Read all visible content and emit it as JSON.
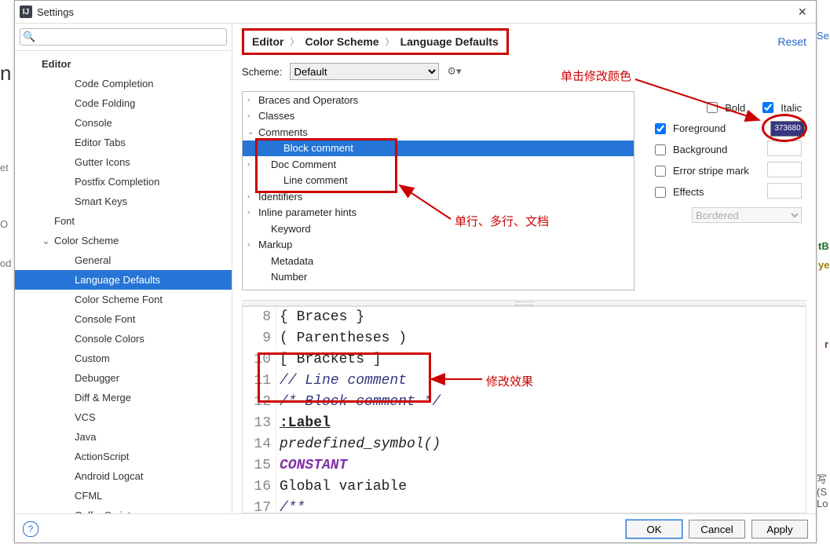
{
  "window": {
    "title": "Settings"
  },
  "search": {
    "placeholder": ""
  },
  "sidebar": {
    "items": [
      {
        "label": "Editor",
        "depth": 0,
        "bold": true,
        "toggle": ""
      },
      {
        "label": "Code Completion",
        "depth": 2
      },
      {
        "label": "Code Folding",
        "depth": 2
      },
      {
        "label": "Console",
        "depth": 2
      },
      {
        "label": "Editor Tabs",
        "depth": 2
      },
      {
        "label": "Gutter Icons",
        "depth": 2
      },
      {
        "label": "Postfix Completion",
        "depth": 2
      },
      {
        "label": "Smart Keys",
        "depth": 2
      },
      {
        "label": "Font",
        "depth": 1
      },
      {
        "label": "Color Scheme",
        "depth": 1,
        "toggle": "v"
      },
      {
        "label": "General",
        "depth": 2
      },
      {
        "label": "Language Defaults",
        "depth": 2,
        "selected": true
      },
      {
        "label": "Color Scheme Font",
        "depth": 2
      },
      {
        "label": "Console Font",
        "depth": 2
      },
      {
        "label": "Console Colors",
        "depth": 2
      },
      {
        "label": "Custom",
        "depth": 2
      },
      {
        "label": "Debugger",
        "depth": 2
      },
      {
        "label": "Diff & Merge",
        "depth": 2
      },
      {
        "label": "VCS",
        "depth": 2
      },
      {
        "label": "Java",
        "depth": 2
      },
      {
        "label": "ActionScript",
        "depth": 2
      },
      {
        "label": "Android Logcat",
        "depth": 2
      },
      {
        "label": "CFML",
        "depth": 2
      },
      {
        "label": "CoffeeScript",
        "depth": 2
      }
    ]
  },
  "breadcrumb": {
    "a": "Editor",
    "b": "Color Scheme",
    "c": "Language Defaults"
  },
  "reset_label": "Reset",
  "scheme": {
    "label": "Scheme:",
    "value": "Default"
  },
  "attrs": {
    "rows": [
      {
        "label": "Braces and Operators",
        "toggle": ">",
        "lv": 0
      },
      {
        "label": "Classes",
        "toggle": ">",
        "lv": 0
      },
      {
        "label": "Comments",
        "toggle": "v",
        "lv": 0
      },
      {
        "label": "Block comment",
        "toggle": "",
        "lv": 2,
        "selected": true
      },
      {
        "label": "Doc Comment",
        "toggle": ">",
        "lv": 1
      },
      {
        "label": "Line comment",
        "toggle": "",
        "lv": 2
      },
      {
        "label": "Identifiers",
        "toggle": ">",
        "lv": 0
      },
      {
        "label": "Inline parameter hints",
        "toggle": ">",
        "lv": 0
      },
      {
        "label": "Keyword",
        "toggle": "",
        "lv": 1
      },
      {
        "label": "Markup",
        "toggle": ">",
        "lv": 0
      },
      {
        "label": "Metadata",
        "toggle": "",
        "lv": 1
      },
      {
        "label": "Number",
        "toggle": "",
        "lv": 1
      }
    ]
  },
  "panel": {
    "bold": "Bold",
    "italic": "Italic",
    "bold_checked": false,
    "italic_checked": true,
    "foreground": "Foreground",
    "fg_checked": true,
    "fg_hex": "373680",
    "background": "Background",
    "bg_checked": false,
    "stripe": "Error stripe mark",
    "stripe_checked": false,
    "effects": "Effects",
    "effects_checked": false,
    "effects_value": "Bordered"
  },
  "preview": {
    "lines": [
      {
        "n": "8",
        "html": "{ Braces }"
      },
      {
        "n": "9",
        "html": "( Parentheses )"
      },
      {
        "n": "10",
        "html": "[ Brackets ]"
      },
      {
        "n": "11",
        "cls": "cm-comment-line",
        "html": "// Line comment"
      },
      {
        "n": "12",
        "cls": "cm-comment-block",
        "html": "/* Block comment */"
      },
      {
        "n": "13",
        "cls": "cm-label",
        "html": ":Label"
      },
      {
        "n": "14",
        "cls": "cm-psym",
        "html": "predefined_symbol()"
      },
      {
        "n": "15",
        "cls": "cm-const",
        "html": "CONSTANT"
      },
      {
        "n": "16",
        "html": "Global variable"
      },
      {
        "n": "17",
        "cls": "cm-comment-block",
        "html": "/**"
      }
    ]
  },
  "buttons": {
    "ok": "OK",
    "cancel": "Cancel",
    "apply": "Apply"
  },
  "annotations": {
    "click_color": "单击修改颜色",
    "comment_types": "单行、多行、文档",
    "effect": "修改效果"
  }
}
